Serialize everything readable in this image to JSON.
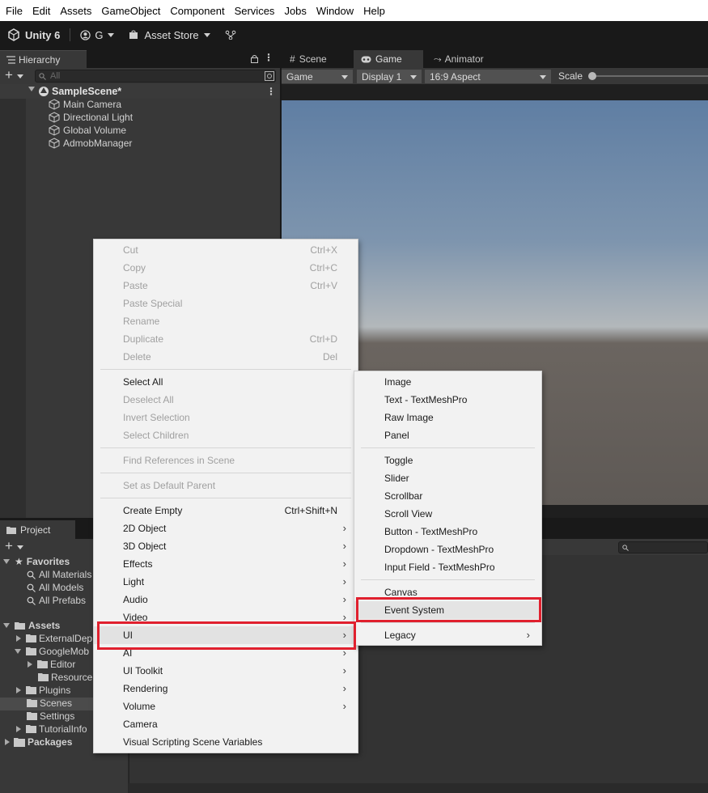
{
  "menubar": [
    "File",
    "Edit",
    "Assets",
    "GameObject",
    "Component",
    "Services",
    "Jobs",
    "Window",
    "Help"
  ],
  "toolbar": {
    "app": "Unity 6",
    "account": "G",
    "asset_store": "Asset Store"
  },
  "hierarchy": {
    "tab": "Hierarchy",
    "search_placeholder": "All",
    "scene": "SampleScene*",
    "objects": [
      "Main Camera",
      "Directional Light",
      "Global Volume",
      "AdmobManager"
    ]
  },
  "game": {
    "tabs": [
      "Scene",
      "Game",
      "Animator"
    ],
    "mode": "Game",
    "display": "Display 1",
    "aspect": "16:9 Aspect",
    "scale": "Scale"
  },
  "project": {
    "tab": "Project",
    "favorites": "Favorites",
    "favorite_items": [
      "All Materials",
      "All Models",
      "All Prefabs"
    ],
    "assets": "Assets",
    "folders": [
      "ExternalDep",
      "GoogleMob",
      "Editor",
      "Resource",
      "Plugins",
      "Scenes",
      "Settings",
      "TutorialInfo"
    ],
    "packages": "Packages"
  },
  "context_menu": {
    "group1": [
      {
        "label": "Cut",
        "shortcut": "Ctrl+X"
      },
      {
        "label": "Copy",
        "shortcut": "Ctrl+C"
      },
      {
        "label": "Paste",
        "shortcut": "Ctrl+V"
      },
      {
        "label": "Paste Special",
        "shortcut": ""
      },
      {
        "label": "Rename",
        "shortcut": ""
      },
      {
        "label": "Duplicate",
        "shortcut": "Ctrl+D"
      },
      {
        "label": "Delete",
        "shortcut": "Del"
      }
    ],
    "group2": [
      "Select All",
      "Deselect All",
      "Invert Selection",
      "Select Children"
    ],
    "find_references": "Find References in Scene",
    "set_default_parent": "Set as Default Parent",
    "create_empty": {
      "label": "Create Empty",
      "shortcut": "Ctrl+Shift+N"
    },
    "create_items": [
      "2D Object",
      "3D Object",
      "Effects",
      "Light",
      "Audio",
      "Video",
      "UI",
      "AI",
      "UI Toolkit",
      "Rendering",
      "Volume",
      "Camera",
      "Visual Scripting Scene Variables"
    ]
  },
  "ui_submenu": {
    "group1": [
      "Image",
      "Text - TextMeshPro",
      "Raw Image",
      "Panel"
    ],
    "group2": [
      "Toggle",
      "Slider",
      "Scrollbar",
      "Scroll View",
      "Button - TextMeshPro",
      "Dropdown - TextMeshPro",
      "Input Field - TextMeshPro"
    ],
    "group3": [
      "Canvas",
      "Event System"
    ],
    "legacy": "Legacy"
  },
  "colors": {
    "highlight": "#e0202e",
    "menu_bg": "#f2f2f2",
    "editor_bg": "#383838"
  }
}
